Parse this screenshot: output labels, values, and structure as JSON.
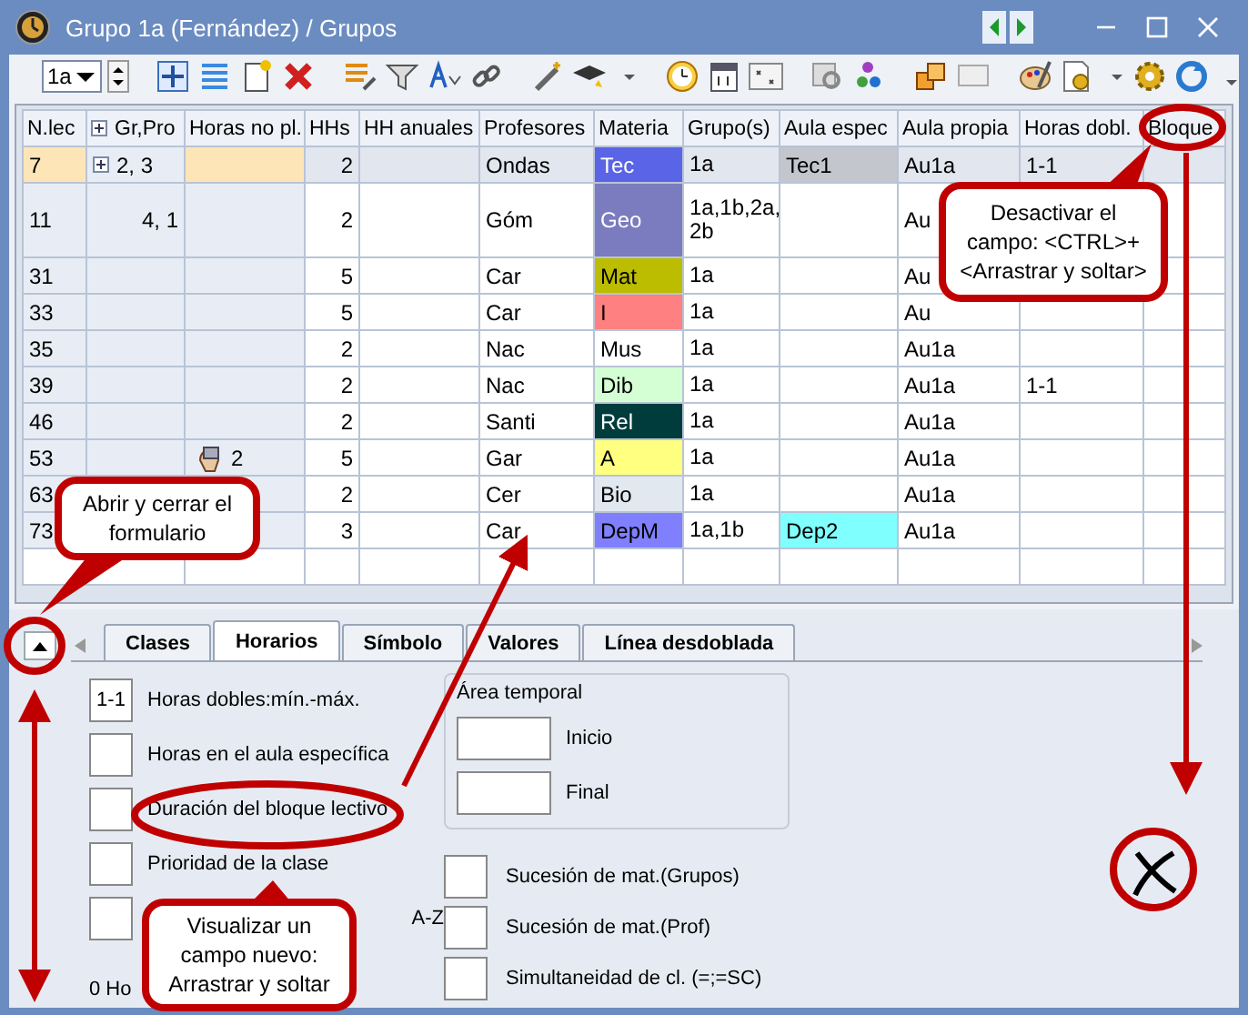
{
  "window": {
    "title": "Grupo 1a (Fernández) / Grupos"
  },
  "toolbar": {
    "combo_value": "1a"
  },
  "table": {
    "columns": [
      "N.lec",
      "Gr,Pro",
      "Horas no pl.",
      "HHs",
      "HH anuales",
      "Profesores",
      "Materia",
      "Grupo(s)",
      "Aula espec",
      "Aula propia",
      "Horas dobl.",
      "Bloque"
    ],
    "rows": [
      {
        "selected": true,
        "expandable": true,
        "n_lec": "7",
        "gr_pro": "2, 3",
        "hhs": "2",
        "profesores": "Ondas",
        "materia": {
          "text": "Tec",
          "color": "#5a64e6"
        },
        "grupos": "1a",
        "aula_espec": {
          "text": "Tec1",
          "color": "#c3c6cc"
        },
        "aula_propia": "Au1a",
        "horas_dobl": "1-1"
      },
      {
        "selected": false,
        "expandable": false,
        "n_lec": "11",
        "gr_pro": "4, 1",
        "hhs": "2",
        "profesores": "Góm",
        "materia": {
          "text": "Geo",
          "color": "#7b7bbf"
        },
        "grupos": "1a,1b,2a, 2b",
        "aula_propia": "Au"
      },
      {
        "selected": false,
        "expandable": false,
        "n_lec": "31",
        "hhs": "5",
        "profesores": "Car",
        "materia": {
          "text": "Mat",
          "color": "#bcbc00"
        },
        "grupos": "1a",
        "aula_propia": "Au"
      },
      {
        "selected": false,
        "expandable": false,
        "n_lec": "33",
        "hhs": "5",
        "profesores": "Car",
        "materia": {
          "text": "I",
          "color": "#ff8080"
        },
        "grupos": "1a",
        "aula_propia": "Au"
      },
      {
        "selected": false,
        "expandable": false,
        "n_lec": "35",
        "hhs": "2",
        "profesores": "Nac",
        "materia": {
          "text": "Mus",
          "color": "#ffffff"
        },
        "grupos": "1a",
        "aula_propia": "Au1a"
      },
      {
        "selected": false,
        "expandable": false,
        "n_lec": "39",
        "hhs": "2",
        "profesores": "Nac",
        "materia": {
          "text": "Dib",
          "color": "#d4ffd4"
        },
        "grupos": "1a",
        "aula_propia": "Au1a",
        "horas_dobl": "1-1"
      },
      {
        "selected": false,
        "expandable": false,
        "n_lec": "46",
        "hhs": "2",
        "profesores": "Santi",
        "materia": {
          "text": "Rel",
          "color": "#003c3c"
        },
        "grupos": "1a",
        "aula_propia": "Au1a"
      },
      {
        "selected": false,
        "expandable": false,
        "n_lec": "53",
        "horas_no_pl": {
          "text": "2",
          "fixed": true
        },
        "hhs": "5",
        "profesores": "Gar",
        "materia": {
          "text": "A",
          "color": "#ffff80"
        },
        "grupos": "1a",
        "aula_propia": "Au1a"
      },
      {
        "selected": false,
        "expandable": false,
        "n_lec": "63",
        "hhs": "2",
        "profesores": "Cer",
        "materia": {
          "text": "Bio",
          "color": "#e2e8f0"
        },
        "grupos": "1a",
        "aula_propia": "Au1a"
      },
      {
        "selected": false,
        "expandable": false,
        "n_lec": "73",
        "hhs": "3",
        "profesores": "Car",
        "materia": {
          "text": "DepM",
          "color": "#8080ff"
        },
        "grupos": "1a,1b",
        "aula_espec": {
          "text": "Dep2",
          "color": "#80ffff"
        },
        "aula_propia": "Au1a"
      }
    ]
  },
  "form": {
    "tabs": [
      {
        "label": "Clases",
        "selected": false
      },
      {
        "label": "Horarios",
        "selected": true
      },
      {
        "label": "Símbolo",
        "selected": false
      },
      {
        "label": "Valores",
        "selected": false
      },
      {
        "label": "Línea desdoblada",
        "selected": false
      }
    ],
    "fields": [
      {
        "kind": "box",
        "value": "1-1",
        "label": "Horas dobles:mín.-máx."
      },
      {
        "kind": "box",
        "label": "Horas en el aula específica"
      },
      {
        "kind": "box",
        "label": "Duración del bloque lectivo"
      },
      {
        "kind": "box",
        "label": "Prioridad de la clase"
      },
      {
        "kind": "box_end",
        "label": "A-Z"
      }
    ],
    "footer_text": "0 Ho",
    "time_area": {
      "title": "Área temporal",
      "fields": [
        {
          "label": "Inicio"
        },
        {
          "label": "Final"
        }
      ]
    },
    "options": [
      {
        "label": "Sucesión de mat.(Grupos)"
      },
      {
        "label": "Sucesión de mat.(Prof)"
      },
      {
        "label": "Simultaneidad de cl. (=;=SC)"
      }
    ]
  },
  "callouts": [
    {
      "text": "Desactivar el campo: <CTRL>+ <Arrastrar y soltar>"
    },
    {
      "text": "Abrir y cerrar el formulario"
    },
    {
      "text": "Visualizar un campo nuevo: Arrastrar y soltar"
    }
  ]
}
